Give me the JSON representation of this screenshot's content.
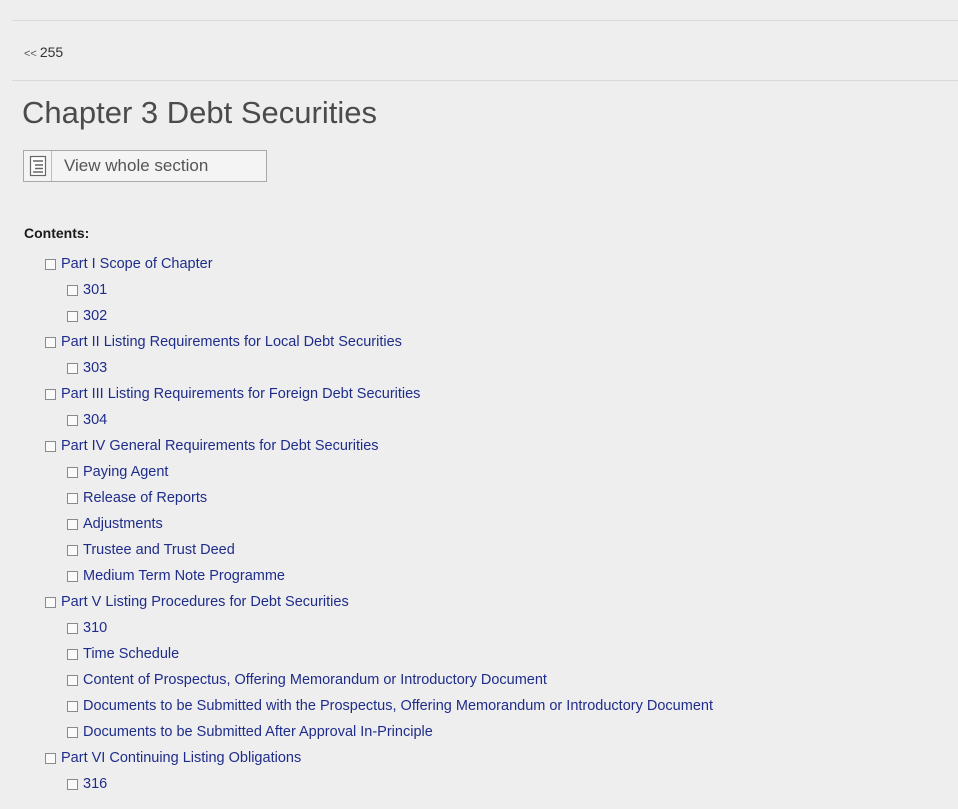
{
  "nav": {
    "prev_chevron": "<<",
    "prev_label": "255"
  },
  "page": {
    "title": "Chapter 3 Debt Securities",
    "view_button_label": "View whole section",
    "contents_heading": "Contents:"
  },
  "toc": [
    {
      "label": "Part I Scope of Chapter",
      "level": 1
    },
    {
      "label": "301",
      "level": 2
    },
    {
      "label": "302",
      "level": 2
    },
    {
      "label": "Part II Listing Requirements for Local Debt Securities",
      "level": 1
    },
    {
      "label": "303",
      "level": 2
    },
    {
      "label": "Part III Listing Requirements for Foreign Debt Securities",
      "level": 1
    },
    {
      "label": "304",
      "level": 2
    },
    {
      "label": "Part IV General Requirements for Debt Securities",
      "level": 1
    },
    {
      "label": "Paying Agent",
      "level": 2
    },
    {
      "label": "Release of Reports",
      "level": 2
    },
    {
      "label": "Adjustments",
      "level": 2
    },
    {
      "label": "Trustee and Trust Deed",
      "level": 2
    },
    {
      "label": "Medium Term Note Programme",
      "level": 2
    },
    {
      "label": "Part V Listing Procedures for Debt Securities",
      "level": 1
    },
    {
      "label": "310",
      "level": 2
    },
    {
      "label": "Time Schedule",
      "level": 2
    },
    {
      "label": "Content of Prospectus, Offering Memorandum or Introductory Document",
      "level": 2
    },
    {
      "label": "Documents to be Submitted with the Prospectus, Offering Memorandum or Introductory Document",
      "level": 2
    },
    {
      "label": "Documents to be Submitted After Approval In-Principle",
      "level": 2
    },
    {
      "label": "Part VI Continuing Listing Obligations",
      "level": 1
    },
    {
      "label": "316",
      "level": 2
    }
  ],
  "colors": {
    "link": "#1f2d8a",
    "title": "#4b4b4b",
    "background": "#eeeeef"
  },
  "icons": {
    "view_button_icon": "outline-list-icon",
    "toc_item_icon": "checkbox-icon"
  }
}
